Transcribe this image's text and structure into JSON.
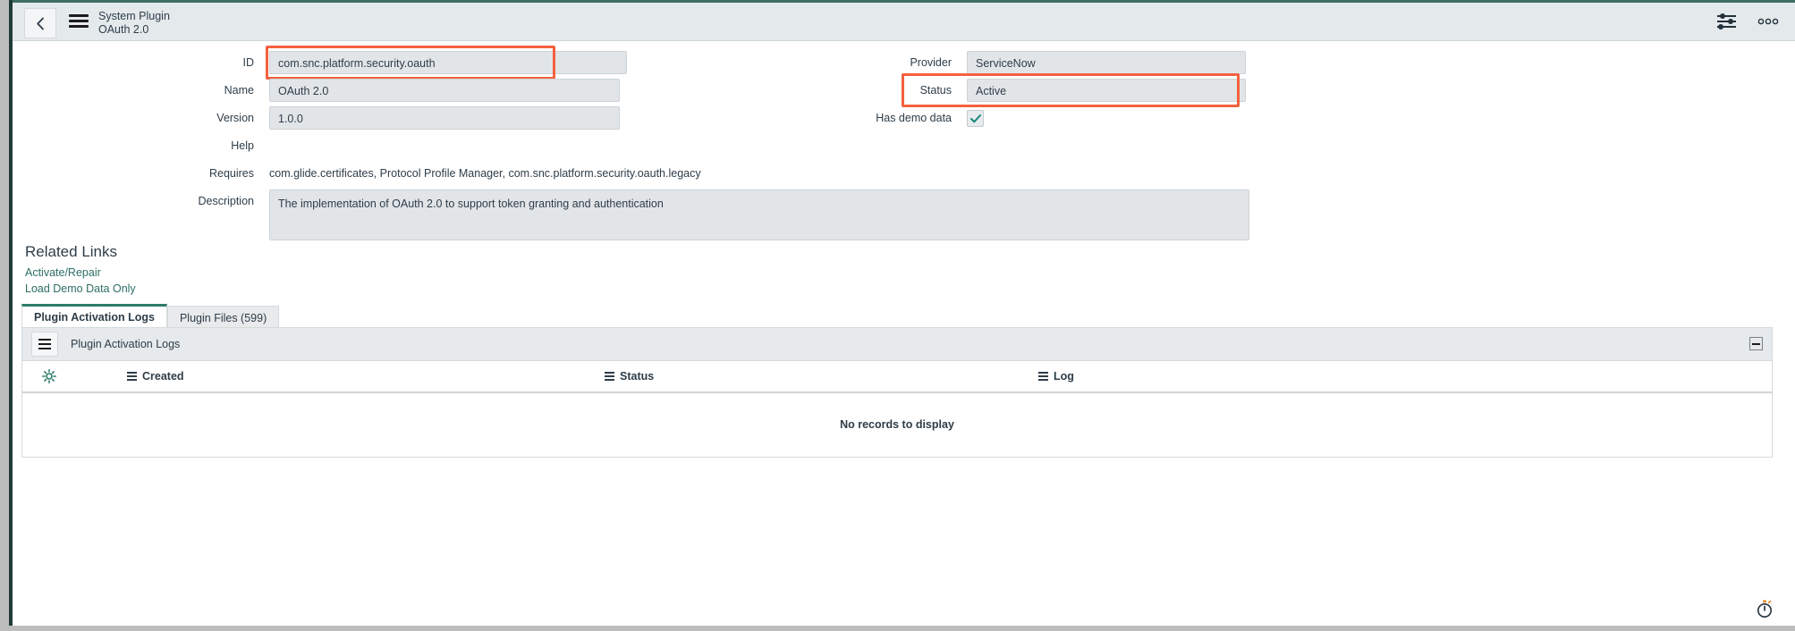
{
  "header": {
    "back_icon": "chevron-left-icon",
    "menu_icon": "hamburger-menu-icon",
    "title": "System Plugin",
    "subtitle": "OAuth 2.0",
    "personalize_icon": "sliders-icon",
    "more_icon": "ellipsis-icon"
  },
  "form": {
    "left_fields": [
      {
        "label": "ID",
        "value": "com.snc.platform.security.oauth",
        "type": "input",
        "highlighted": true
      },
      {
        "label": "Name",
        "value": "OAuth 2.0",
        "type": "input",
        "highlighted": false
      },
      {
        "label": "Version",
        "value": "1.0.0",
        "type": "input",
        "highlighted": false
      },
      {
        "label": "Help",
        "value": "",
        "type": "empty",
        "highlighted": false
      },
      {
        "label": "Requires",
        "value": "com.glide.certificates, Protocol Profile Manager, com.snc.platform.security.oauth.legacy",
        "type": "plain",
        "highlighted": false
      },
      {
        "label": "Description",
        "value": "The implementation of OAuth 2.0 to support token granting and authentication",
        "type": "textarea",
        "highlighted": false
      }
    ],
    "right_fields": [
      {
        "label": "Provider",
        "value": "ServiceNow",
        "type": "input",
        "highlighted": false
      },
      {
        "label": "Status",
        "value": "Active",
        "type": "input",
        "highlighted": true
      },
      {
        "label": "Has demo data",
        "value": "checked",
        "type": "checkbox",
        "highlighted": false
      }
    ],
    "highlight_color": "#f4603e",
    "field_background": "#e2e5e8"
  },
  "related_links": {
    "title": "Related Links",
    "links": [
      {
        "label": "Activate/Repair"
      },
      {
        "label": "Load Demo Data Only"
      }
    ],
    "link_color": "#2d6e63"
  },
  "tabs": [
    {
      "label": "Plugin Activation Logs",
      "active": true
    },
    {
      "label": "Plugin Files (599)",
      "active": false
    }
  ],
  "list_panel": {
    "menu_icon": "list-menu-icon",
    "title": "Plugin Activation Logs",
    "collapse_icon": "collapse-icon",
    "gear_icon": "gear-icon",
    "columns": [
      {
        "label": "Created"
      },
      {
        "label": "Status"
      },
      {
        "label": "Log"
      }
    ],
    "empty_message": "No records to display",
    "rows": []
  },
  "footer": {
    "timer_icon": "stopwatch-icon"
  }
}
